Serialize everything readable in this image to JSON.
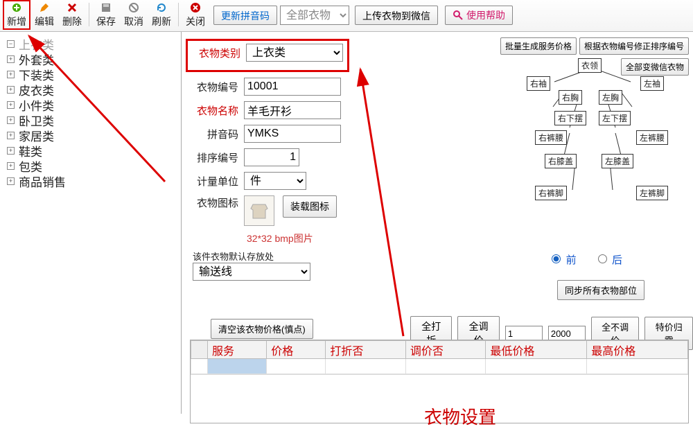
{
  "toolbar": {
    "add": "新增",
    "edit": "编辑",
    "del": "删除",
    "save": "保存",
    "cancel": "取消",
    "refresh": "刷新",
    "close": "关闭",
    "updatePinyin": "更新拼音码",
    "allClothes": "全部衣物",
    "uploadWx": "上传衣物到微信",
    "help": "使用帮助"
  },
  "tree": [
    "上衣类",
    "外套类",
    "下装类",
    "皮衣类",
    "小件类",
    "卧卫类",
    "家居类",
    "鞋类",
    "包类",
    "商品销售"
  ],
  "rightButtons": {
    "batchPrice": "批量生成服务价格",
    "fixOrder": "根据衣物编号修正排序编号",
    "allWxClothes": "全部变微信衣物"
  },
  "form": {
    "categoryLabel": "衣物类别",
    "categoryValue": "上衣类",
    "codeLabel": "衣物编号",
    "codeValue": "10001",
    "nameLabel": "衣物名称",
    "nameValue": "羊毛开衫",
    "pinyinLabel": "拼音码",
    "pinyinValue": "YMKS",
    "sortLabel": "排序编号",
    "sortValue": "1",
    "unitLabel": "计量单位",
    "unitValue": "件",
    "iconLabel": "衣物图标",
    "loadIcon": "装载图标",
    "iconHint": "32*32 bmp图片",
    "defaultPlaceLabel": "该件衣物默认存放处",
    "defaultPlaceValue": "输送线",
    "clearPrice": "清空该衣物价格(慎点)"
  },
  "diagram": {
    "collar": "衣领",
    "rsleeve": "右袖",
    "lsleeve": "左袖",
    "rchest": "右胸",
    "lchest": "左胸",
    "rhem": "右下摆",
    "lhem": "左下摆",
    "rwaist": "右裤腰",
    "lwaist": "左裤腰",
    "rknee": "右膝盖",
    "lknee": "左膝盖",
    "rfoot": "右裤脚",
    "lfoot": "左裤脚"
  },
  "radios": {
    "front": "前",
    "back": "后"
  },
  "syncParts": "同步所有衣物部位",
  "priceRow": {
    "allDiscount": "全打折",
    "allAdjust": "全调价",
    "v1": "1",
    "v2": "2000",
    "noAdjust": "全不调价",
    "clearSpecial": "特价归零"
  },
  "grid": {
    "h1": "服务",
    "h2": "价格",
    "h3": "打折否",
    "h4": "调价否",
    "h5": "最低价格",
    "h6": "最高价格"
  },
  "bigTitle": "衣物设置"
}
